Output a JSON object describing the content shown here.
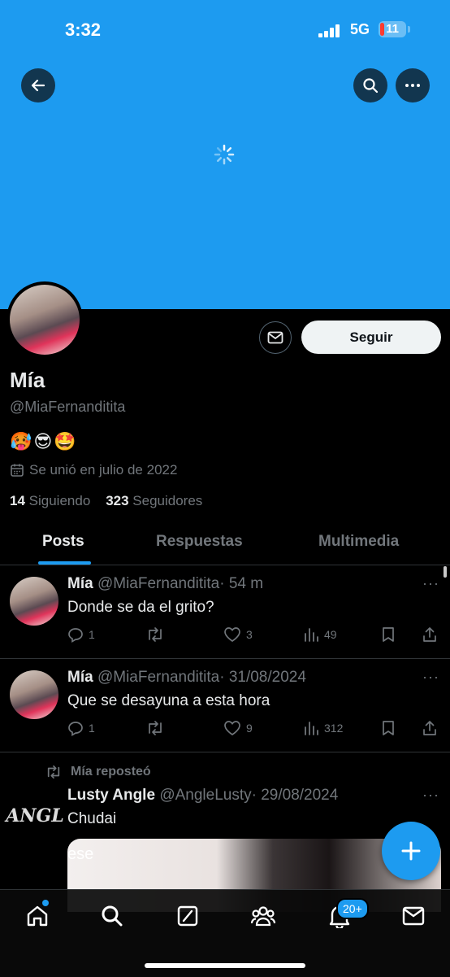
{
  "status_bar": {
    "time": "3:32",
    "network": "5G",
    "battery": "11"
  },
  "profile": {
    "name": "Mía",
    "handle": "@MiaFernanditita",
    "bio": "🥵😎🤩",
    "joined": "Se unió en julio de 2022",
    "following_count": "14",
    "following_label": "Siguiendo",
    "followers_count": "323",
    "followers_label": "Seguidores",
    "follow_button": "Seguir"
  },
  "tabs": [
    {
      "label": "Posts",
      "active": true
    },
    {
      "label": "Respuestas",
      "active": false
    },
    {
      "label": "Multimedia",
      "active": false
    }
  ],
  "posts": [
    {
      "name": "Mía",
      "handle": "@MiaFernanditita",
      "time": "· 54 m",
      "text": "Donde se da el grito?",
      "replies": "1",
      "reposts": "",
      "likes": "3",
      "views": "49"
    },
    {
      "name": "Mía",
      "handle": "@MiaFernanditita",
      "time": "· 31/08/2024",
      "text": "Que se desayuna a esta hora",
      "replies": "1",
      "reposts": "",
      "likes": "9",
      "views": "312"
    }
  ],
  "repost": {
    "label": "Mía reposteó",
    "name": "Lusty Angle",
    "handle": "@AngleLusty",
    "time": "· 29/08/2024",
    "text": "Chudai",
    "avatar_text": "ANGL",
    "media_text": "ese"
  },
  "nav": {
    "notifications_badge": "20+"
  },
  "colors": {
    "accent": "#1d9bf0",
    "background": "#000000",
    "muted": "#71767b"
  }
}
